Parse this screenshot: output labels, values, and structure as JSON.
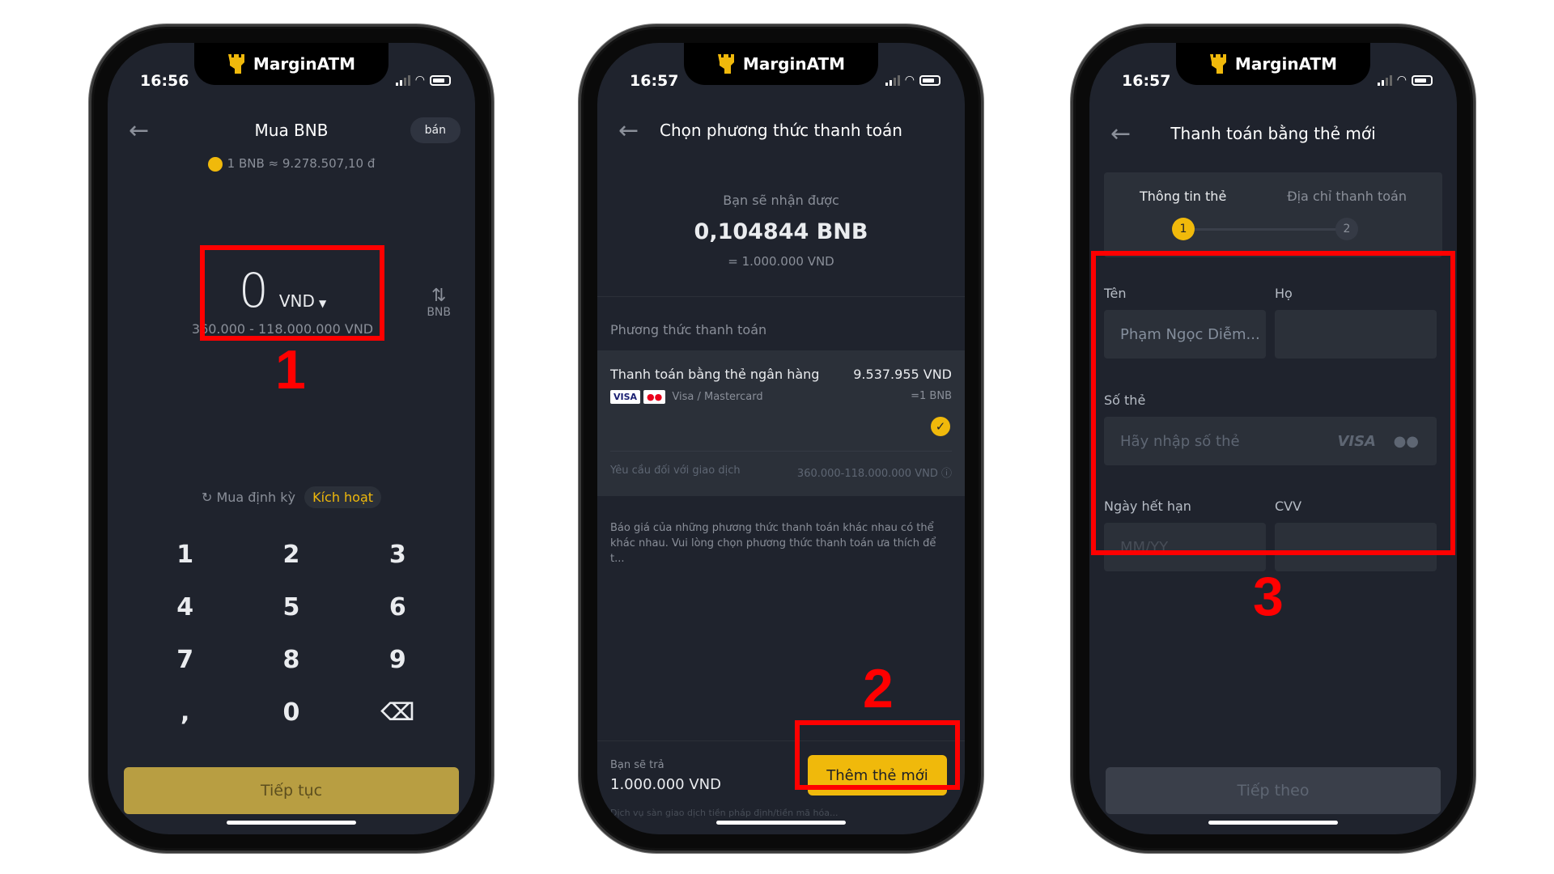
{
  "brand": {
    "name": "MarginATM",
    "logo_color": "#f0b90b"
  },
  "colors": {
    "accent": "#f0b90b",
    "annotation": "#ff0000",
    "screen_bg": "#1f232d"
  },
  "phone1": {
    "time": "16:56",
    "title": "Mua BNB",
    "sell_button": "bán",
    "rate": "1 BNB ≈ 9.278.507,10 đ",
    "amount": "0",
    "currency": "VND",
    "range": "360.000 - 118.000.000 VND",
    "swap_label": "BNB",
    "recurring_label": "Mua định kỳ",
    "activate_label": "Kích hoạt",
    "keys": [
      "1",
      "2",
      "3",
      "4",
      "5",
      "6",
      "7",
      "8",
      "9",
      ",",
      "0",
      "⌫"
    ],
    "continue_button": "Tiếp tục",
    "annotation": "1"
  },
  "phone2": {
    "time": "16:57",
    "title": "Chọn phương thức thanh toán",
    "receive_label": "Bạn sẽ nhận được",
    "receive_amount": "0,104844 BNB",
    "receive_equiv": "= 1.000.000 VND",
    "method_section": "Phương thức thanh toán",
    "method_name": "Thanh toán bằng thẻ ngân hàng",
    "method_price": "9.537.955 VND",
    "method_cards": "Visa / Mastercard",
    "method_unit": "=1 BNB",
    "limit_label": "Yêu cầu đối với giao dịch",
    "limit_value": "360.000-118.000.000 VND",
    "note": "Báo giá của những phương thức thanh toán khác nhau có thể khác nhau. Vui lòng chọn phương thức thanh toán ưa thích để t...",
    "pay_label": "Bạn sẽ trả",
    "pay_amount": "1.000.000 VND",
    "add_card_button": "Thêm thẻ mới",
    "footer_note": "Dịch vụ sàn giao dịch tiền pháp định/tiền mã hóa...",
    "annotation": "2"
  },
  "phone3": {
    "time": "16:57",
    "title": "Thanh toán bằng thẻ mới",
    "step1_label": "Thông tin thẻ",
    "step2_label": "Địa chỉ thanh toán",
    "step1_num": "1",
    "step2_num": "2",
    "first_name_label": "Tên",
    "first_name_value": "Phạm Ngọc Diễm...",
    "last_name_label": "Họ",
    "last_name_value": "",
    "card_number_label": "Số thẻ",
    "card_number_placeholder": "Hãy nhập số thẻ",
    "expiry_label": "Ngày hết hạn",
    "expiry_placeholder": "MM/YY",
    "cvv_label": "CVV",
    "cvv_value": "",
    "next_button": "Tiếp theo",
    "annotation": "3"
  }
}
